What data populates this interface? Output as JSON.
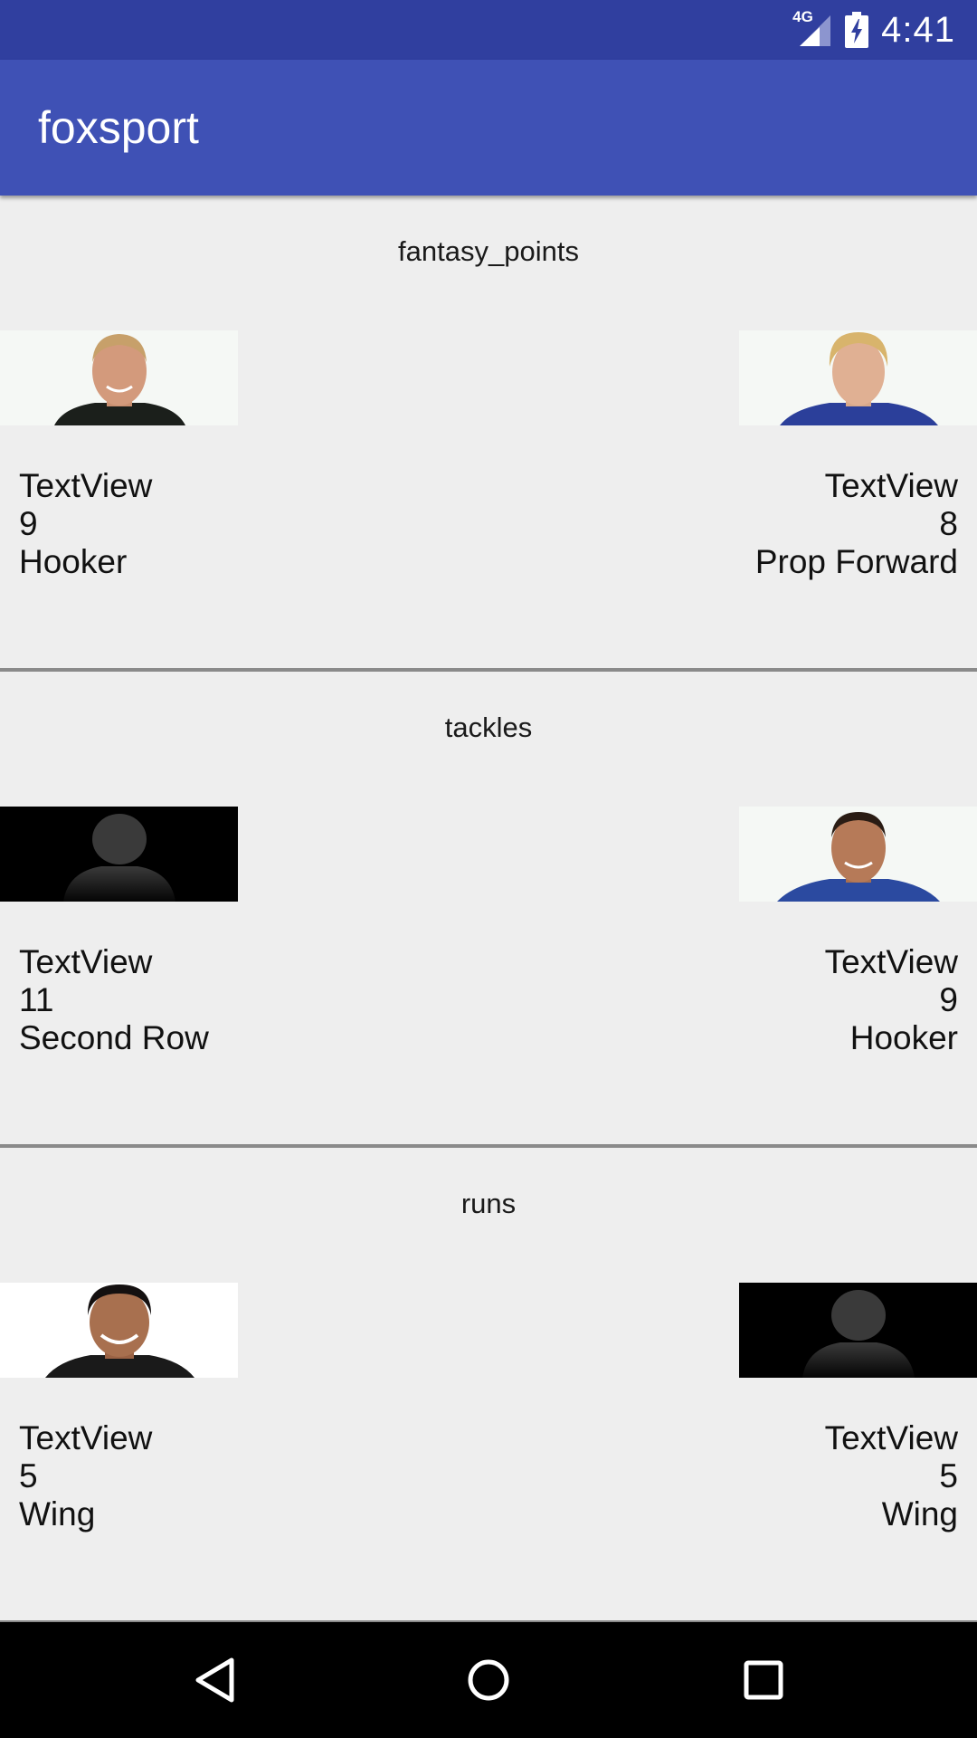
{
  "status_bar": {
    "network": "4G",
    "time": "4:41"
  },
  "app_bar": {
    "title": "foxsport"
  },
  "sections": [
    {
      "title": "fantasy_points",
      "left": {
        "photo": "player-photo",
        "name": "TextView",
        "value": "9",
        "position": "Hooker"
      },
      "right": {
        "photo": "player-photo",
        "name": "TextView",
        "value": "8",
        "position": "Prop Forward"
      }
    },
    {
      "title": "tackles",
      "left": {
        "photo": "placeholder-silhouette",
        "name": "TextView",
        "value": "11",
        "position": "Second Row"
      },
      "right": {
        "photo": "player-photo",
        "name": "TextView",
        "value": "9",
        "position": "Hooker"
      }
    },
    {
      "title": "runs",
      "left": {
        "photo": "player-photo",
        "name": "TextView",
        "value": "5",
        "position": "Wing"
      },
      "right": {
        "photo": "placeholder-silhouette",
        "name": "TextView",
        "value": "5",
        "position": "Wing"
      }
    }
  ],
  "colors": {
    "status_bar": "#303f9f",
    "app_bar": "#3f51b5",
    "background": "#eeeeee",
    "divider": "#8a8a8a"
  },
  "nav_bar": {
    "icons": [
      "back-icon",
      "home-icon",
      "recents-icon"
    ]
  }
}
